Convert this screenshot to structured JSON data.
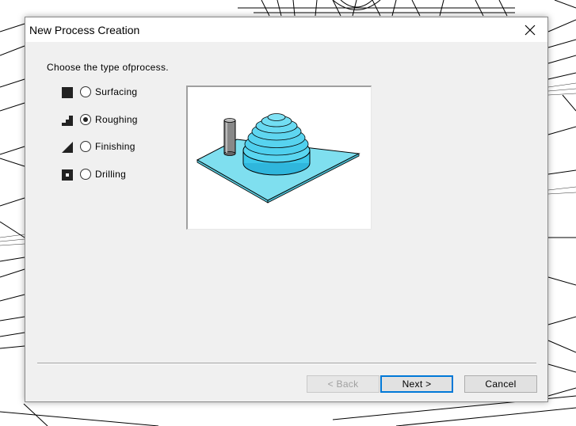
{
  "dialog": {
    "title": "New Process Creation",
    "prompt": "Choose the type ofprocess.",
    "options": [
      {
        "label": "Surfacing",
        "icon": "surfacing-icon",
        "checked": false
      },
      {
        "label": "Roughing",
        "icon": "roughing-icon",
        "checked": true
      },
      {
        "label": "Finishing",
        "icon": "finishing-icon",
        "checked": false
      },
      {
        "label": "Drilling",
        "icon": "drilling-icon",
        "checked": false
      }
    ],
    "buttons": {
      "back": "< Back",
      "next": "Next >",
      "cancel": "Cancel"
    }
  },
  "colors": {
    "accent": "#0078d7",
    "preview_plate": "#7fdfef",
    "preview_dome": "#3cc8ea"
  }
}
